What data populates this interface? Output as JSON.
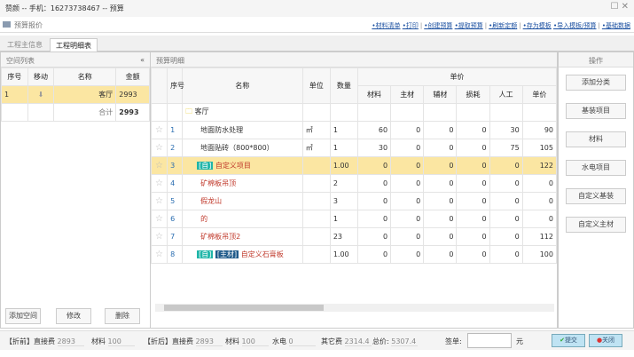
{
  "window": {
    "title": "赞颜 -- 手机：16273738467 -- 预算",
    "maximize_icon": "maximize-icon",
    "close_icon": "close-icon"
  },
  "toolbar": {
    "label": "预算报价",
    "links": [
      "•材料清单",
      "•打印",
      "•创建预算",
      "•提取预算",
      "•刷新定额",
      "•存为模板",
      "•导入模板/预算",
      "•基础数据"
    ]
  },
  "tabs": [
    {
      "label": "工程主信息",
      "active": false
    },
    {
      "label": "工程明细表",
      "active": true
    }
  ],
  "left": {
    "title": "空间列表",
    "collapse": "«",
    "headers": [
      "序号",
      "移动",
      "名称",
      "金额"
    ],
    "rows": [
      {
        "no": "1",
        "name": "客厅",
        "amount": "2993"
      }
    ],
    "total_label": "合计",
    "total": "2993",
    "buttons": [
      "添加空间",
      "修改",
      "删除"
    ]
  },
  "main": {
    "title": "预算明细",
    "headers": {
      "no": "序号",
      "name": "名称",
      "unit": "单位",
      "qty": "数量",
      "unit_price": "单价",
      "sub": [
        "材料",
        "主材",
        "辅材",
        "损耗",
        "人工",
        "单价"
      ]
    },
    "group": "客厅",
    "rows": [
      {
        "no": "1",
        "tags": [],
        "name": "地面防水处理",
        "unit": "㎡",
        "qty": "1",
        "v": [
          "60",
          "0",
          "0",
          "0",
          "30",
          "90"
        ],
        "red": false
      },
      {
        "no": "2",
        "tags": [],
        "name": "地面贴砖（800*800）",
        "unit": "㎡",
        "qty": "1",
        "v": [
          "30",
          "0",
          "0",
          "0",
          "75",
          "105"
        ],
        "red": false
      },
      {
        "no": "3",
        "tags": [
          "[自]"
        ],
        "name": "自定义项目",
        "unit": "",
        "qty": "1.00",
        "v": [
          "0",
          "0",
          "0",
          "0",
          "0",
          "122"
        ],
        "red": true,
        "selected": true
      },
      {
        "no": "4",
        "tags": [],
        "name": "矿棉板吊顶",
        "unit": "",
        "qty": "2",
        "v": [
          "0",
          "0",
          "0",
          "0",
          "0",
          "0"
        ],
        "red": true
      },
      {
        "no": "5",
        "tags": [],
        "name": "假龙山",
        "unit": "",
        "qty": "3",
        "v": [
          "0",
          "0",
          "0",
          "0",
          "0",
          "0"
        ],
        "red": true
      },
      {
        "no": "6",
        "tags": [],
        "name": "的",
        "unit": "",
        "qty": "1",
        "v": [
          "0",
          "0",
          "0",
          "0",
          "0",
          "0"
        ],
        "red": true
      },
      {
        "no": "7",
        "tags": [],
        "name": "矿棉板吊顶2",
        "unit": "",
        "qty": "23",
        "v": [
          "0",
          "0",
          "0",
          "0",
          "0",
          "112"
        ],
        "red": true
      },
      {
        "no": "8",
        "tags": [
          "[自]",
          "[主材]"
        ],
        "name": "自定义石膏板",
        "unit": "",
        "qty": "1.00",
        "v": [
          "0",
          "0",
          "0",
          "0",
          "0",
          "100"
        ],
        "red": true
      }
    ]
  },
  "right": {
    "title": "操作",
    "buttons": [
      "添加分类",
      "基装项目",
      "材料",
      "水电项目",
      "自定义基装",
      "自定义主材"
    ]
  },
  "footer": {
    "before_label": "【折前】直接费",
    "before_direct": "2893",
    "before_mat_label": "材料",
    "before_mat": "100",
    "after_label": "【折后】直接费",
    "after_direct": "2893",
    "after_mat_label": "材料",
    "after_mat": "100",
    "water_label": "水电",
    "water": "0",
    "other_label": "其它费",
    "other": "2314.4",
    "total_label": "总价:",
    "total": "5307.4",
    "sign_label": "签单:",
    "sign_value": "",
    "unit": "元",
    "submit": "提交",
    "close": "关闭"
  },
  "colors": {
    "selected_row": "#fbe6a2",
    "red_text": "#c0392b",
    "tag_self": "#1fb5a8",
    "tag_main": "#1f5a8a",
    "link": "#1a4fa0"
  }
}
